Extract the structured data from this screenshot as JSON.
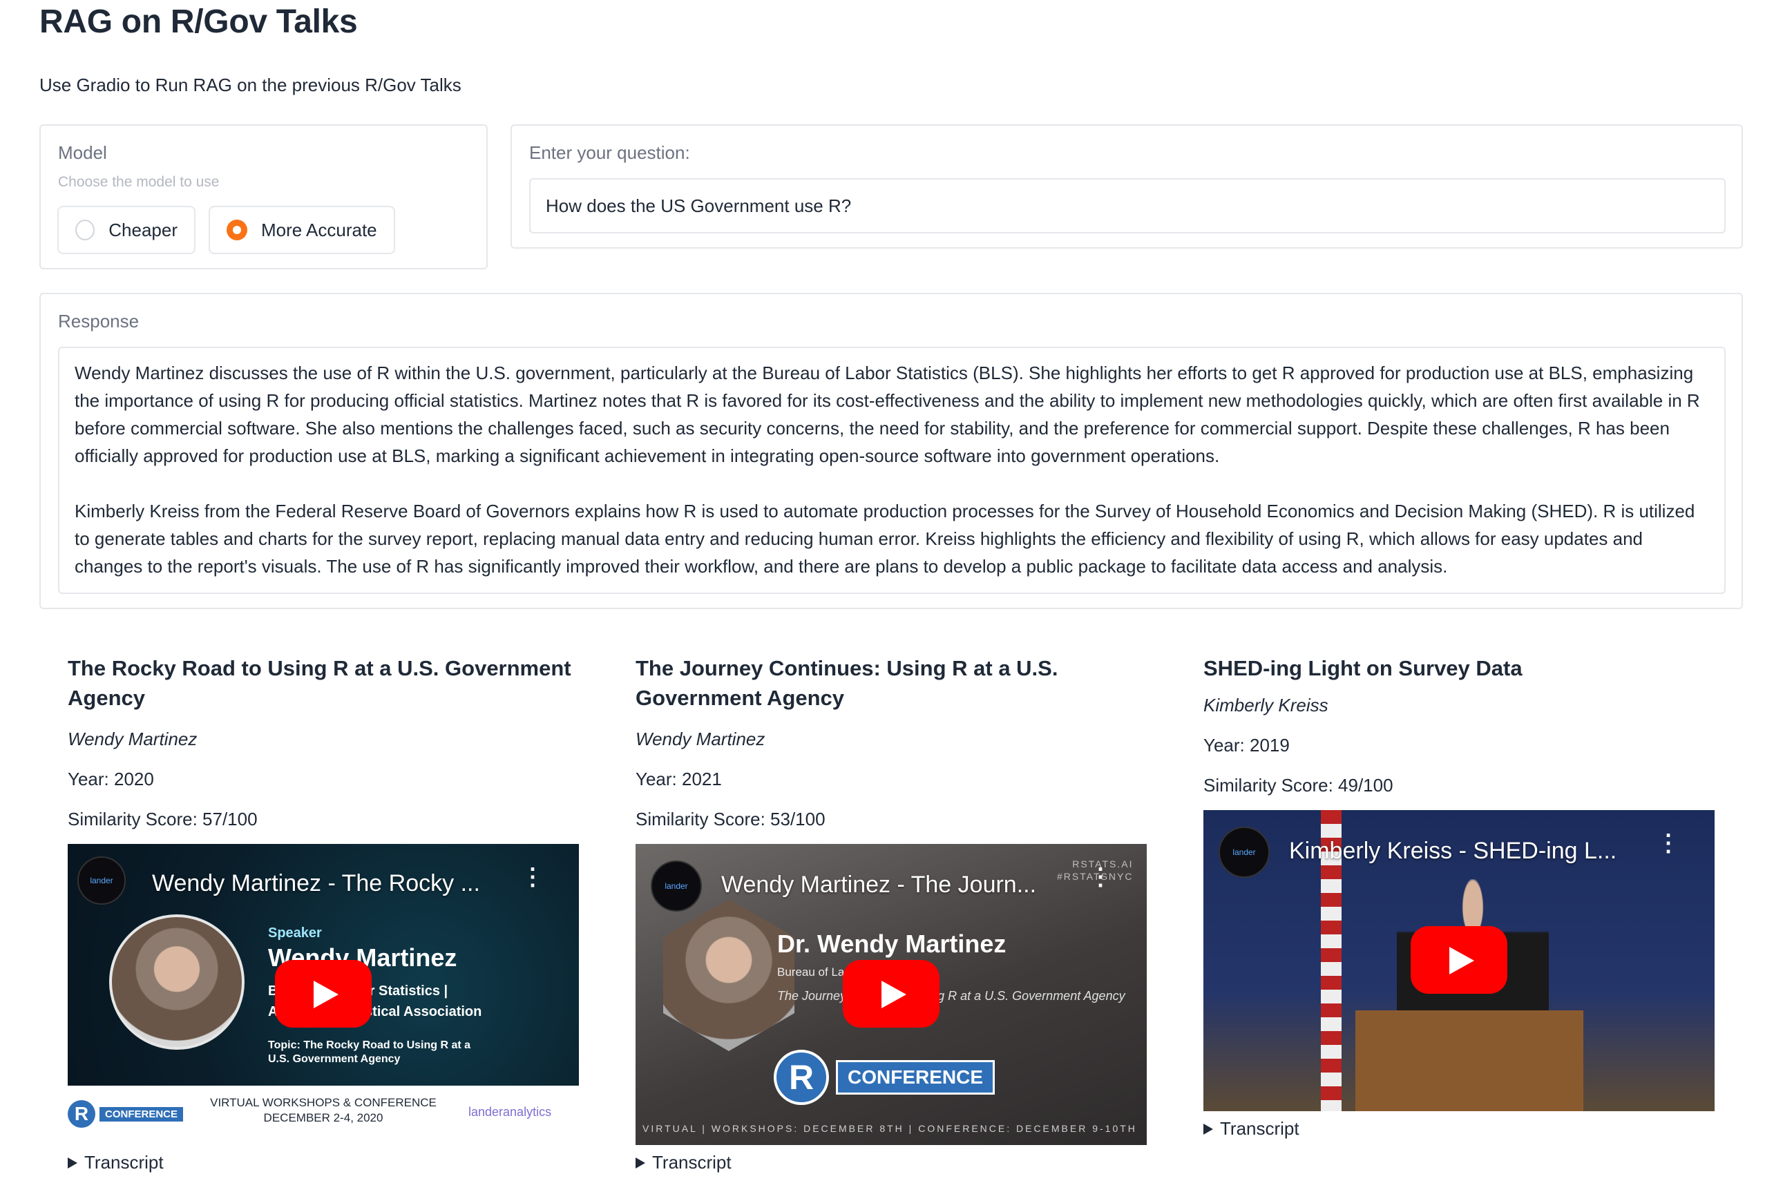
{
  "app": {
    "title": "RAG on R/Gov Talks",
    "subtitle": "Use Gradio to Run RAG on the previous R/Gov Talks"
  },
  "model": {
    "label": "Model",
    "info": "Choose the model to use",
    "options": [
      "Cheaper",
      "More Accurate"
    ],
    "selected": "More Accurate",
    "accent_color": "#f97316"
  },
  "question": {
    "label": "Enter your question:",
    "value": "How does the US Government use R?"
  },
  "response": {
    "label": "Response",
    "paragraphs": [
      "Wendy Martinez discusses the use of R within the U.S. government, particularly at the Bureau of Labor Statistics (BLS). She highlights her efforts to get R approved for production use at BLS, emphasizing the importance of using R for producing official statistics. Martinez notes that R is favored for its cost-effectiveness and the ability to implement new methodologies quickly, which are often first available in R before commercial software. She also mentions the challenges faced, such as security concerns, the need for stability, and the preference for commercial support. Despite these challenges, R has been officially approved for production use at BLS, marking a significant achievement in integrating open-source software into government operations.",
      "Kimberly Kreiss from the Federal Reserve Board of Governors explains how R is used to automate production processes for the Survey of Household Economics and Decision Making (SHED). R is utilized to generate tables and charts for the survey report, replacing manual data entry and reducing human error. Kreiss highlights the efficiency and flexibility of using R, which allows for easy updates and changes to the report's visuals. The use of R has significantly improved their workflow, and there are plans to develop a public package to facilitate data access and analysis."
    ]
  },
  "results": [
    {
      "title": "The Rocky Road to Using R at a U.S. Government Agency",
      "author": "Wendy Martinez",
      "year": "Year: 2020",
      "score": "Similarity Score: 57/100",
      "video_title": "Wendy Martinez - The Rocky ...",
      "transcript_label": "Transcript",
      "thumb": {
        "speaker_label": "Speaker",
        "speaker_name": "Wendy Martinez",
        "org_line1": "Bureau of Labor Statistics |",
        "org_line2": "American Statistical Association",
        "topic": "Topic: The Rocky Road to Using R at a U.S. Government Agency",
        "conference": "CONFERENCE",
        "workshop_line1": "VIRTUAL WORKSHOPS & CONFERENCE",
        "workshop_line2": "DECEMBER 2-4, 2020",
        "lander": "landeranalytics"
      }
    },
    {
      "title": "The Journey Continues: Using R at a U.S. Government Agency",
      "author": "Wendy Martinez",
      "year": "Year: 2021",
      "score": "Similarity Score: 53/100",
      "video_title": "Wendy Martinez - The Journ...",
      "transcript_label": "Transcript",
      "thumb": {
        "speaker_name": "Dr. Wendy Martinez",
        "org": "Bureau of La",
        "topic": "The Journey Continues: Using R at a U.S. Government Agency",
        "conference": "CONFERENCE",
        "rstats": "RSTATS.AI",
        "hashtag": "#RSTATSNYC",
        "footer": "VIRTUAL | WORKSHOPS: DECEMBER 8TH | CONFERENCE: DECEMBER 9-10TH"
      }
    },
    {
      "title": "SHED-ing Light on Survey Data",
      "author": "Kimberly Kreiss",
      "year": "Year: 2019",
      "score": "Similarity Score: 49/100",
      "video_title": "Kimberly Kreiss - SHED-ing L...",
      "transcript_label": "Transcript"
    }
  ],
  "icons": {
    "play": "youtube-play-icon",
    "menu": "more-vertical-icon",
    "expand": "triangle-right-icon"
  }
}
